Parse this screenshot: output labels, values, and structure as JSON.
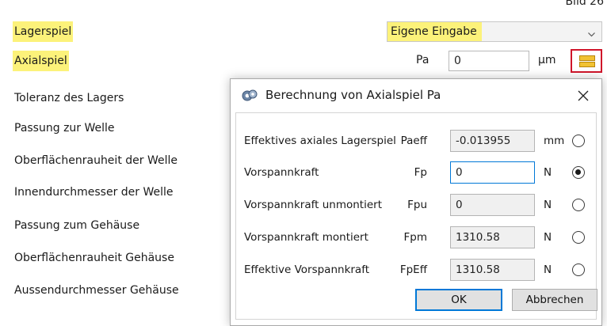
{
  "figure_label": "Bild 26",
  "main": {
    "rows": [
      {
        "label": "Lagerspiel"
      },
      {
        "label": "Axialspiel"
      },
      {
        "label": "Toleranz des Lagers"
      },
      {
        "label": "Passung zur Welle"
      },
      {
        "label": "Oberflächenrauheit der Welle"
      },
      {
        "label": "Innendurchmesser der Welle"
      },
      {
        "label": "Passung zum Gehäuse"
      },
      {
        "label": "Oberflächenrauheit Gehäuse"
      },
      {
        "label": "Aussendurchmesser Gehäuse"
      }
    ],
    "lagerspiel_select": {
      "value": "Eigene Eingabe"
    },
    "axialspiel": {
      "symbol": "Pa",
      "value": "0",
      "unit": "µm"
    },
    "highlight_color": "#fcf27a",
    "calc_button_border_color": "#d0152a"
  },
  "dialog": {
    "title": "Berechnung von Axialspiel Pa",
    "fields": [
      {
        "label": "Effektives axiales Lagerspiel",
        "symbol": "Paeff",
        "value": "-0.013955",
        "unit": "mm",
        "selected": false
      },
      {
        "label": "Vorspannkraft",
        "symbol": "Fp",
        "value": "0",
        "unit": "N",
        "selected": true
      },
      {
        "label": "Vorspannkraft unmontiert",
        "symbol": "Fpu",
        "value": "0",
        "unit": "N",
        "selected": false
      },
      {
        "label": "Vorspannkraft montiert",
        "symbol": "Fpm",
        "value": "1310.58",
        "unit": "N",
        "selected": false
      },
      {
        "label": "Effektive Vorspannkraft",
        "symbol": "FpEff",
        "value": "1310.58",
        "unit": "N",
        "selected": false
      }
    ],
    "ok_label": "OK",
    "cancel_label": "Abbrechen"
  }
}
